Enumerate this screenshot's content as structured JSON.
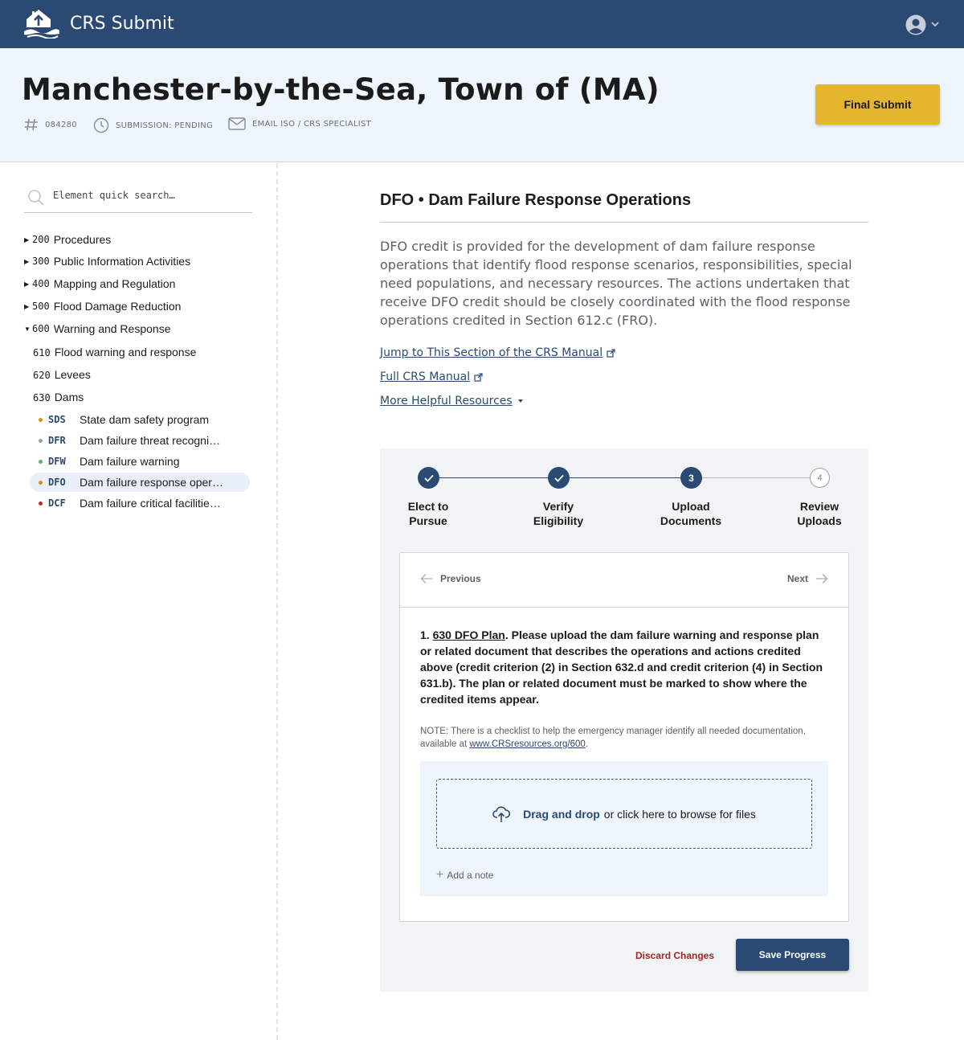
{
  "app": {
    "title": "CRS Submit"
  },
  "header": {
    "community": "Manchester-by-the-Sea, Town of (MA)",
    "community_id": "084280",
    "status": "SUBMISSION: PENDING",
    "email": "EMAIL ISO / CRS SPECIALIST",
    "final_submit": "Final Submit"
  },
  "sidebar": {
    "search_placeholder": "Element quick search…",
    "groups": [
      {
        "code": "200",
        "label": "Procedures",
        "expanded": false
      },
      {
        "code": "300",
        "label": "Public Information Activities",
        "expanded": false
      },
      {
        "code": "400",
        "label": "Mapping and Regulation",
        "expanded": false
      },
      {
        "code": "500",
        "label": "Flood Damage Reduction",
        "expanded": false
      },
      {
        "code": "600",
        "label": "Warning and Response",
        "expanded": true
      }
    ],
    "activities": [
      {
        "code": "610",
        "label": "Flood warning and response"
      },
      {
        "code": "620",
        "label": "Levees"
      },
      {
        "code": "630",
        "label": "Dams"
      }
    ],
    "elements": [
      {
        "code": "SDS",
        "label": "State dam safety program",
        "status_color": "#e08a1e",
        "active": false
      },
      {
        "code": "DFR",
        "label": "Dam failure threat recogni…",
        "status_color": "#9aa0a6",
        "active": false
      },
      {
        "code": "DFW",
        "label": "Dam failure warning",
        "status_color": "#5fb36b",
        "active": false
      },
      {
        "code": "DFO",
        "label": "Dam failure response oper…",
        "status_color": "#e08a1e",
        "active": true
      },
      {
        "code": "DCF",
        "label": "Dam failure critical facilitie…",
        "status_color": "#c62828",
        "active": false
      }
    ]
  },
  "main": {
    "title": "DFO • Dam Failure Response Operations",
    "description": "DFO credit is provided for the development of dam failure response operations that identify flood response scenarios, responsibilities, special need populations, and necessary resources. The actions undertaken that receive DFO credit should be closely coordinated with the flood response operations credited in Section 612.c (FRO).",
    "links": {
      "jump": "Jump to This Section of the CRS Manual",
      "full": "Full CRS Manual",
      "more": "More Helpful Resources"
    }
  },
  "wizard": {
    "steps": [
      {
        "num": "1",
        "label_1": "Elect to",
        "label_2": "Pursue",
        "state": "done"
      },
      {
        "num": "2",
        "label_1": "Verify",
        "label_2": "Eligibility",
        "state": "done"
      },
      {
        "num": "3",
        "label_1": "Upload",
        "label_2": "Documents",
        "state": "current"
      },
      {
        "num": "4",
        "label_1": "Review",
        "label_2": "Uploads",
        "state": "todo"
      }
    ],
    "prev": "Previous",
    "next": "Next",
    "requirement": {
      "num": "1.",
      "link": "630 DFO Plan",
      "text": ". Please upload the dam failure warning and response plan or related document that describes the operations and actions credited above (credit criterion (2) in Section 632.d and credit criterion (4) in Section 631.b). The plan or related document must be marked to show where the credited items appear."
    },
    "note": {
      "text": "NOTE: There is a checklist to help the emergency manager identify all needed documentation, available at ",
      "link": "www.CRSresources.org/600",
      "end": "."
    },
    "dropzone": {
      "strong": "Drag and drop",
      "rest": "or click here to browse for files"
    },
    "add_note": "Add a note",
    "discard": "Discard Changes",
    "save": "Save Progress"
  },
  "colors": {
    "primary": "#2a4a73",
    "accent": "#e5b52d",
    "danger": "#b31f1f",
    "header_bg": "#eff5fd"
  }
}
